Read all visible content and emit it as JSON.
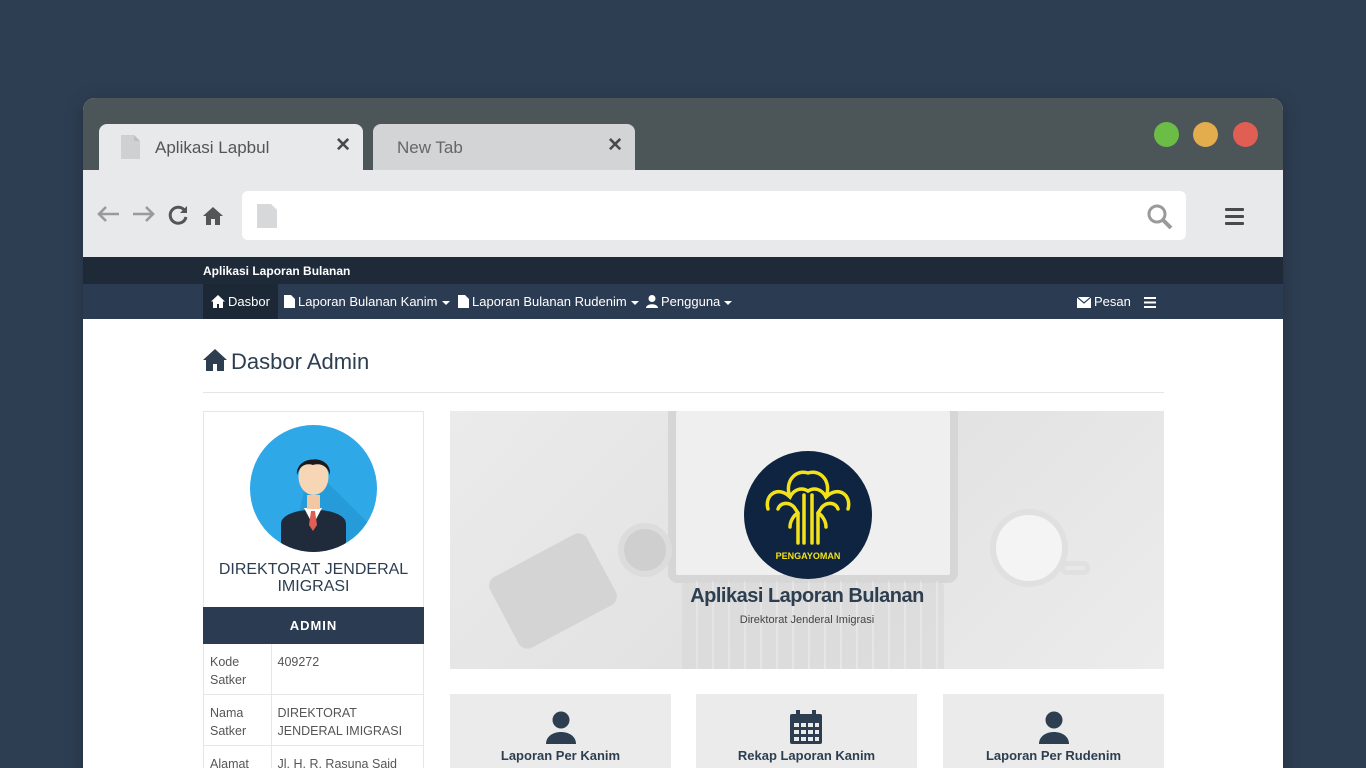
{
  "browser": {
    "tabs": [
      {
        "title": "Aplikasi Lapbul"
      },
      {
        "title": "New Tab"
      }
    ],
    "url": "",
    "colors": {
      "frame": "#4c5659",
      "toolbar": "#e8e9eb",
      "traffic_green": "#6cbd45",
      "traffic_yellow": "#e3ad4e",
      "traffic_red": "#e15e55"
    }
  },
  "site": {
    "brand": "Aplikasi Laporan Bulanan",
    "nav": {
      "dasbor": "Dasbor",
      "kanim": "Laporan Bulanan Kanim",
      "rudenim": "Laporan Bulanan Rudenim",
      "pengguna": "Pengguna",
      "pesan": "Pesan"
    },
    "colors": {
      "header_dark": "#1e2a38",
      "nav": "#2b3b51"
    }
  },
  "page": {
    "title": "Dasbor Admin"
  },
  "profile": {
    "name": "DIREKTORAT JENDERAL IMIGRASI",
    "role": "ADMIN",
    "rows": [
      {
        "key": "Kode Satker",
        "value": "409272"
      },
      {
        "key": "Nama Satker",
        "value": "DIREKTORAT JENDERAL IMIGRASI"
      },
      {
        "key": "Alamat",
        "value": "Jl. H. R. Rasuna Said Kav."
      }
    ]
  },
  "banner": {
    "logo_text": "PENGAYOMAN",
    "title": "Aplikasi Laporan Bulanan",
    "subtitle": "Direktorat Jenderal Imigrasi"
  },
  "cards": [
    {
      "label": "Laporan Per Kanim",
      "icon": "user-icon"
    },
    {
      "label": "Rekap Laporan Kanim",
      "icon": "calendar-icon"
    },
    {
      "label": "Laporan Per Rudenim",
      "icon": "user-icon"
    }
  ]
}
